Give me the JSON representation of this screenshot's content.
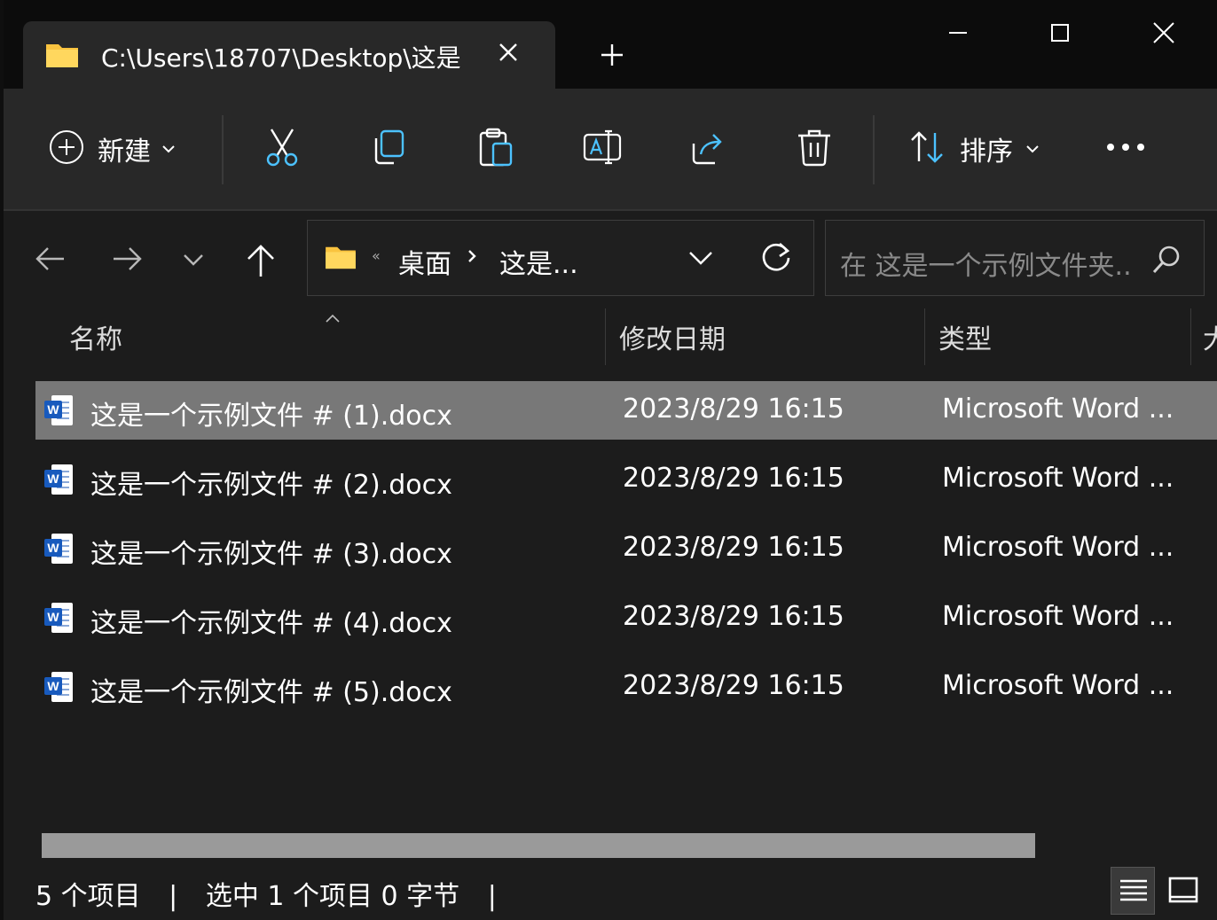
{
  "tab": {
    "title": "C:\\Users\\18707\\Desktop\\这是",
    "close_icon": "close-icon"
  },
  "toolbar": {
    "new_label": "新建",
    "sort_label": "排序",
    "icons": [
      "plus-circle-icon",
      "cut-icon",
      "copy-icon",
      "paste-icon",
      "rename-icon",
      "share-icon",
      "delete-icon",
      "sort-icon",
      "more-icon"
    ]
  },
  "address": {
    "overflow": "«",
    "crumbs": [
      "桌面",
      "这是..."
    ]
  },
  "search": {
    "placeholder": "在 这是一个示例文件夹..."
  },
  "columns": {
    "name": "名称",
    "modified": "修改日期",
    "type": "类型",
    "size": "大"
  },
  "files": [
    {
      "name": "这是一个示例文件 # (1).docx",
      "modified": "2023/8/29 16:15",
      "type": "Microsoft Word ...",
      "selected": true
    },
    {
      "name": "这是一个示例文件 # (2).docx",
      "modified": "2023/8/29 16:15",
      "type": "Microsoft Word ...",
      "selected": false
    },
    {
      "name": "这是一个示例文件 # (3).docx",
      "modified": "2023/8/29 16:15",
      "type": "Microsoft Word ...",
      "selected": false
    },
    {
      "name": "这是一个示例文件 # (4).docx",
      "modified": "2023/8/29 16:15",
      "type": "Microsoft Word ...",
      "selected": false
    },
    {
      "name": "这是一个示例文件 # (5).docx",
      "modified": "2023/8/29 16:15",
      "type": "Microsoft Word ...",
      "selected": false
    }
  ],
  "status": {
    "count": "5 个项目",
    "divider": "|",
    "selection": "选中 1 个项目  0 字节",
    "divider2": "|"
  },
  "colors": {
    "accent": "#4cc2ff",
    "folder": "#f9c33f",
    "selected_row": "#787878",
    "word_blue": "#185abd"
  }
}
